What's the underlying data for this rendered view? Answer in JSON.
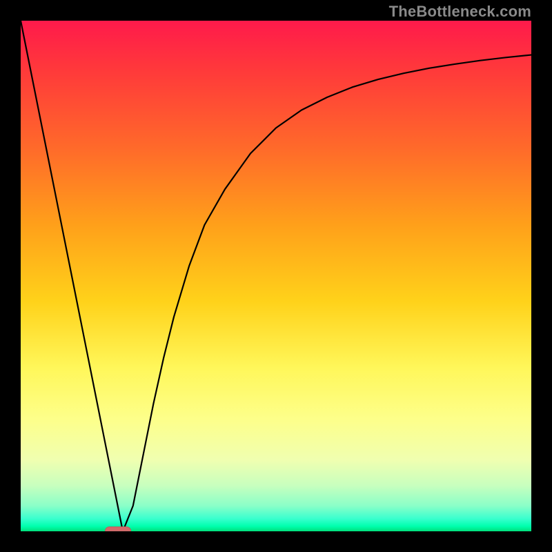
{
  "watermark": "TheBottleneck.com",
  "chart_data": {
    "type": "line",
    "title": "",
    "xlabel": "",
    "ylabel": "",
    "xlim": [
      0,
      100
    ],
    "ylim": [
      0,
      100
    ],
    "x": [
      0,
      5,
      10,
      15,
      18,
      19,
      20,
      22,
      24,
      26,
      28,
      30,
      33,
      36,
      40,
      45,
      50,
      55,
      60,
      65,
      70,
      75,
      80,
      85,
      90,
      95,
      100
    ],
    "values": [
      100,
      75,
      50,
      25,
      10,
      5,
      0,
      5,
      15,
      25,
      34,
      42,
      52,
      60,
      67,
      74,
      79,
      82.5,
      85,
      87,
      88.5,
      89.7,
      90.7,
      91.5,
      92.2,
      92.8,
      93.3
    ],
    "marker": {
      "x": 19,
      "y": 0
    },
    "grid": false,
    "legend": false
  }
}
